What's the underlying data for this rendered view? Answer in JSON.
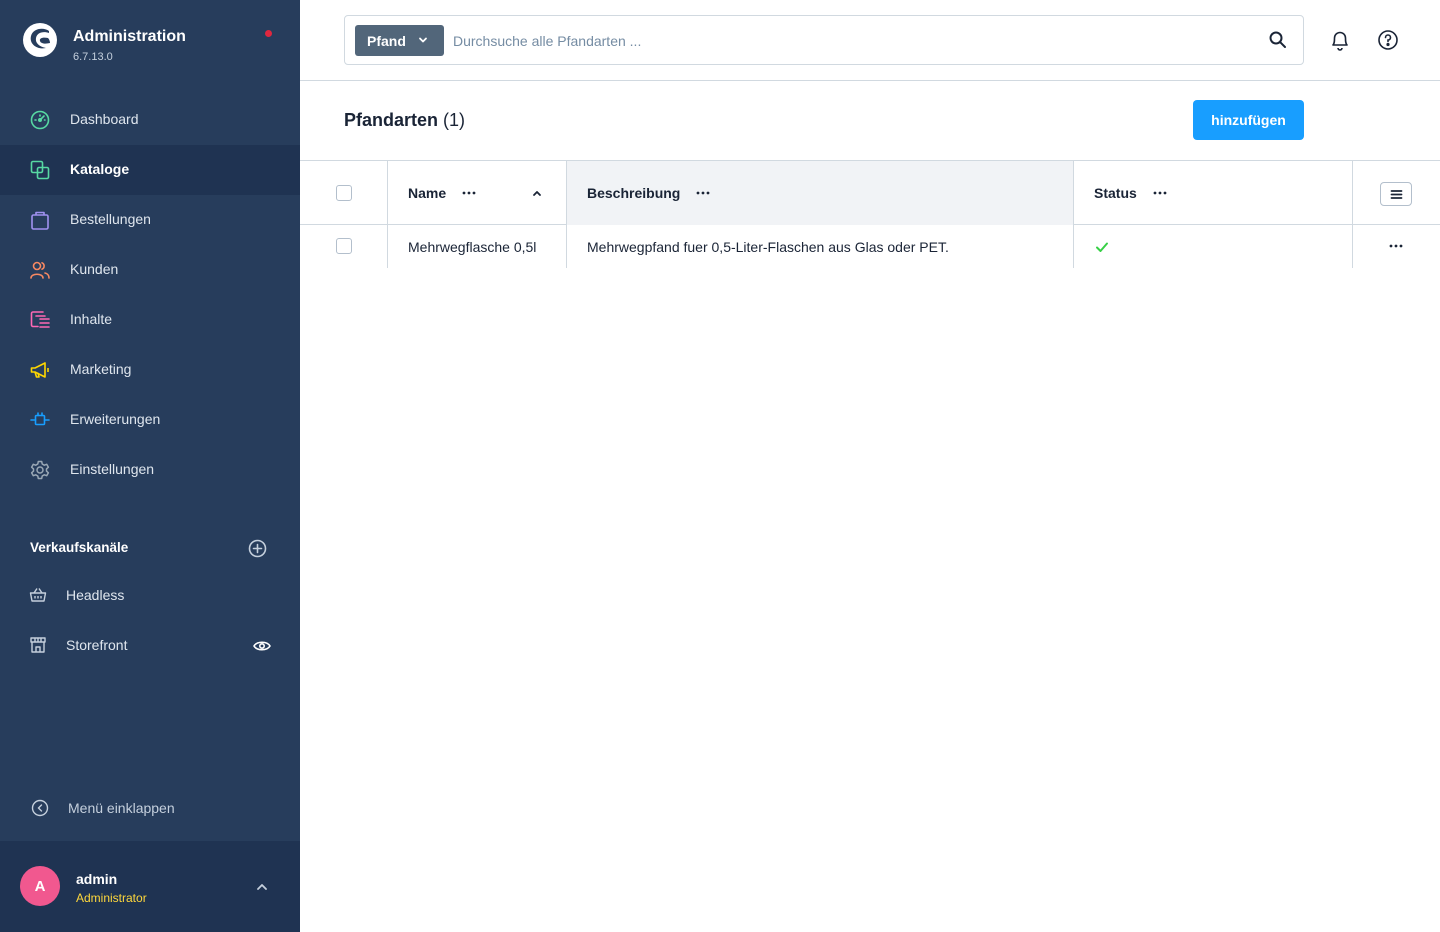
{
  "app": {
    "title": "Administration",
    "version": "6.7.13.0"
  },
  "nav": {
    "items": [
      {
        "label": "Dashboard",
        "icon": "dashboard-icon",
        "color": "#57d9a3"
      },
      {
        "label": "Kataloge",
        "icon": "catalog-icon",
        "color": "#57d9a3",
        "active": true
      },
      {
        "label": "Bestellungen",
        "icon": "shopping-bag-icon",
        "color": "#a092f0"
      },
      {
        "label": "Kunden",
        "icon": "customers-icon",
        "color": "#f88962"
      },
      {
        "label": "Inhalte",
        "icon": "content-icon",
        "color": "#ff68b4"
      },
      {
        "label": "Marketing",
        "icon": "megaphone-icon",
        "color": "#ffd700"
      },
      {
        "label": "Erweiterungen",
        "icon": "plugin-icon",
        "color": "#189eff"
      },
      {
        "label": "Einstellungen",
        "icon": "gear-icon",
        "color": "#9aa8b5"
      }
    ]
  },
  "sales_channels": {
    "title": "Verkaufskanäle",
    "items": [
      {
        "label": "Headless",
        "icon": "basket-icon"
      },
      {
        "label": "Storefront",
        "icon": "storefront-icon"
      }
    ]
  },
  "collapse_label": "Menü einklappen",
  "user": {
    "initial": "A",
    "name": "admin",
    "role": "Administrator"
  },
  "search": {
    "type_label": "Pfand",
    "placeholder": "Durchsuche alle Pfandarten ..."
  },
  "page": {
    "title": "Pfandarten",
    "count": "(1)",
    "add_label": "hinzufügen"
  },
  "grid": {
    "columns": [
      {
        "label": "Name"
      },
      {
        "label": "Beschreibung"
      },
      {
        "label": "Status"
      }
    ],
    "rows": [
      {
        "name": "Mehrwegflasche 0,5l",
        "description": "Mehrwegpfand fuer 0,5-Liter-Flaschen aus Glas oder PET.",
        "status": true
      }
    ]
  },
  "colors": {
    "sidebar_bg": "#273d5c",
    "sidebar_active": "#1f3352",
    "primary": "#189eff",
    "status_active": "#37d046",
    "notification_dot": "#e0273f"
  }
}
